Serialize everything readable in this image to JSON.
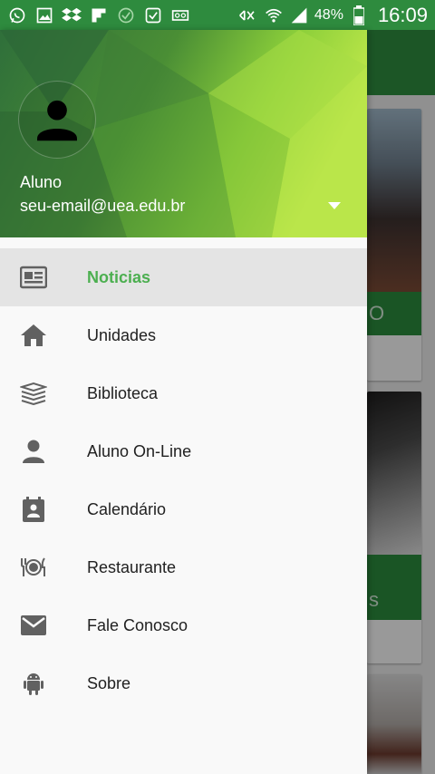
{
  "status_bar": {
    "battery": "48%",
    "time": "16:09",
    "left_icons": [
      "whatsapp-icon",
      "gallery-icon",
      "dropbox-icon",
      "flipboard-icon",
      "check-circle-icon",
      "checkbox-icon",
      "voicemail-icon"
    ],
    "right_icons": [
      "mute-icon",
      "wifi-icon",
      "signal-icon",
      "battery-icon"
    ]
  },
  "drawer": {
    "user": {
      "name": "Aluno",
      "email": "seu-email@uea.edu.br"
    },
    "items": [
      {
        "label": "Noticias",
        "icon": "newspaper-icon",
        "active": true
      },
      {
        "label": "Unidades",
        "icon": "home-icon",
        "active": false
      },
      {
        "label": "Biblioteca",
        "icon": "books-icon",
        "active": false
      },
      {
        "label": "Aluno On-Line",
        "icon": "person-icon",
        "active": false
      },
      {
        "label": "Calendário",
        "icon": "contact-calendar-icon",
        "active": false
      },
      {
        "label": "Restaurante",
        "icon": "restaurant-icon",
        "active": false
      },
      {
        "label": "Fale Conosco",
        "icon": "mail-icon",
        "active": false
      },
      {
        "label": "Sobre",
        "icon": "android-icon",
        "active": false
      }
    ]
  },
  "background": {
    "card1_partial_text": "O",
    "card2_partial_text": "s"
  },
  "colors": {
    "primary": "#2e8b3e",
    "accent": "#4caf50",
    "icon": "#616161",
    "text": "#212121"
  }
}
